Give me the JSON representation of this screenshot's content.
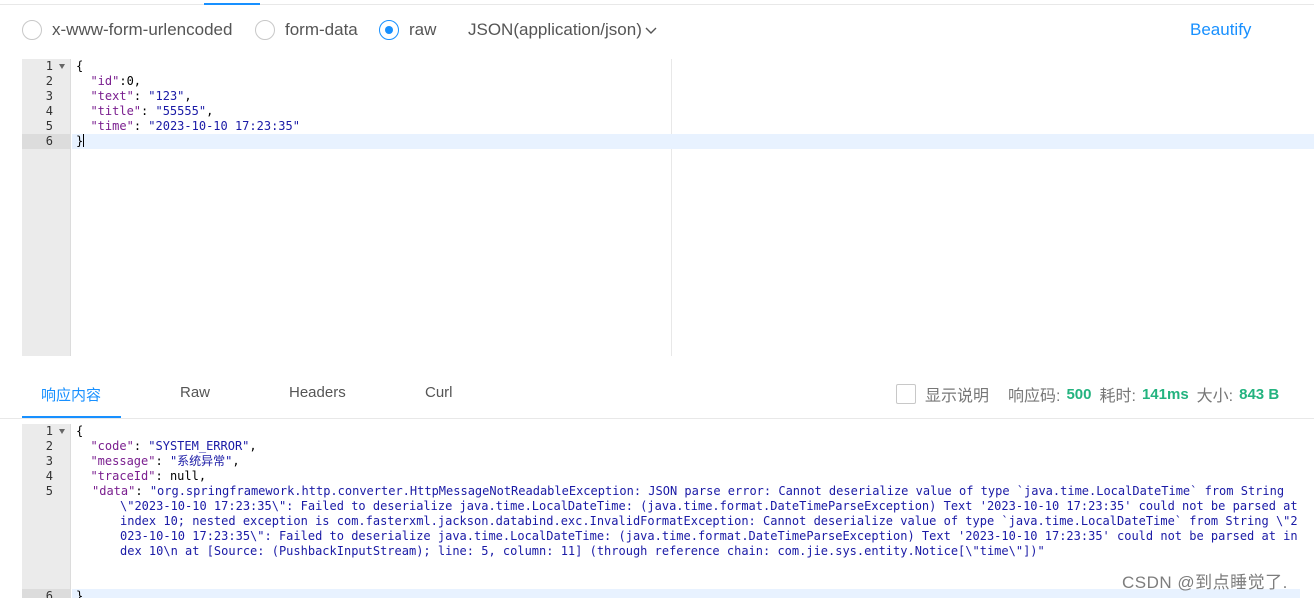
{
  "body_types": {
    "options": [
      {
        "label": "x-www-form-urlencoded",
        "checked": false
      },
      {
        "label": "form-data",
        "checked": false
      },
      {
        "label": "raw",
        "checked": true
      }
    ],
    "content_type": "JSON(application/json)",
    "beautify_label": "Beautify"
  },
  "request_editor": {
    "line_numbers": [
      "1",
      "2",
      "3",
      "4",
      "5",
      "6"
    ],
    "lines": {
      "l1": "{",
      "l2_key": "\"id\"",
      "l2_rest": ":0,",
      "l3_key": "\"text\"",
      "l3_val": "\"123\"",
      "l4_key": "\"title\"",
      "l4_val": "\"55555\"",
      "l5_key": "\"time\"",
      "l5_val": "\"2023-10-10 17:23:35\"",
      "l6": "}"
    }
  },
  "response": {
    "tabs": [
      "响应内容",
      "Raw",
      "Headers",
      "Curl"
    ],
    "show_desc_label": "显示说明",
    "status_label": "响应码:",
    "status_value": "500",
    "time_label": "耗时:",
    "time_value": "141ms",
    "size_label": "大小:",
    "size_value": "843 B"
  },
  "response_editor": {
    "line_numbers": [
      "1",
      "2",
      "3",
      "4",
      "5",
      "6"
    ],
    "lines": {
      "l1": "{",
      "l2_key": "\"code\"",
      "l2_val": "\"SYSTEM_ERROR\"",
      "l3_key": "\"message\"",
      "l3_val": "\"系统异常\"",
      "l4_key": "\"traceId\"",
      "l4_val": "null",
      "l5_key": "\"data\"",
      "l5_val": "\"org.springframework.http.converter.HttpMessageNotReadableException: JSON parse error: Cannot deserialize value of type `java.time.LocalDateTime` from String \\\"2023-10-10 17:23:35\\\": Failed to deserialize java.time.LocalDateTime: (java.time.format.DateTimeParseException) Text '2023-10-10 17:23:35' could not be parsed at index 10; nested exception is com.fasterxml.jackson.databind.exc.InvalidFormatException: Cannot deserialize value of type `java.time.LocalDateTime` from String \\\"2023-10-10 17:23:35\\\": Failed to deserialize java.time.LocalDateTime: (java.time.format.DateTimeParseException) Text '2023-10-10 17:23:35' could not be parsed at index 10\\n at [Source: (PushbackInputStream); line: 5, column: 11] (through reference chain: com.jie.sys.entity.Notice[\\\"time\\\"])\"",
      "l6": "}"
    }
  },
  "watermark": "CSDN @到点睡觉了.",
  "colors": {
    "accent": "#1890ff",
    "success_value": "#23b37f",
    "json_key": "#7a1e8f",
    "json_string": "#1a1aa6"
  }
}
